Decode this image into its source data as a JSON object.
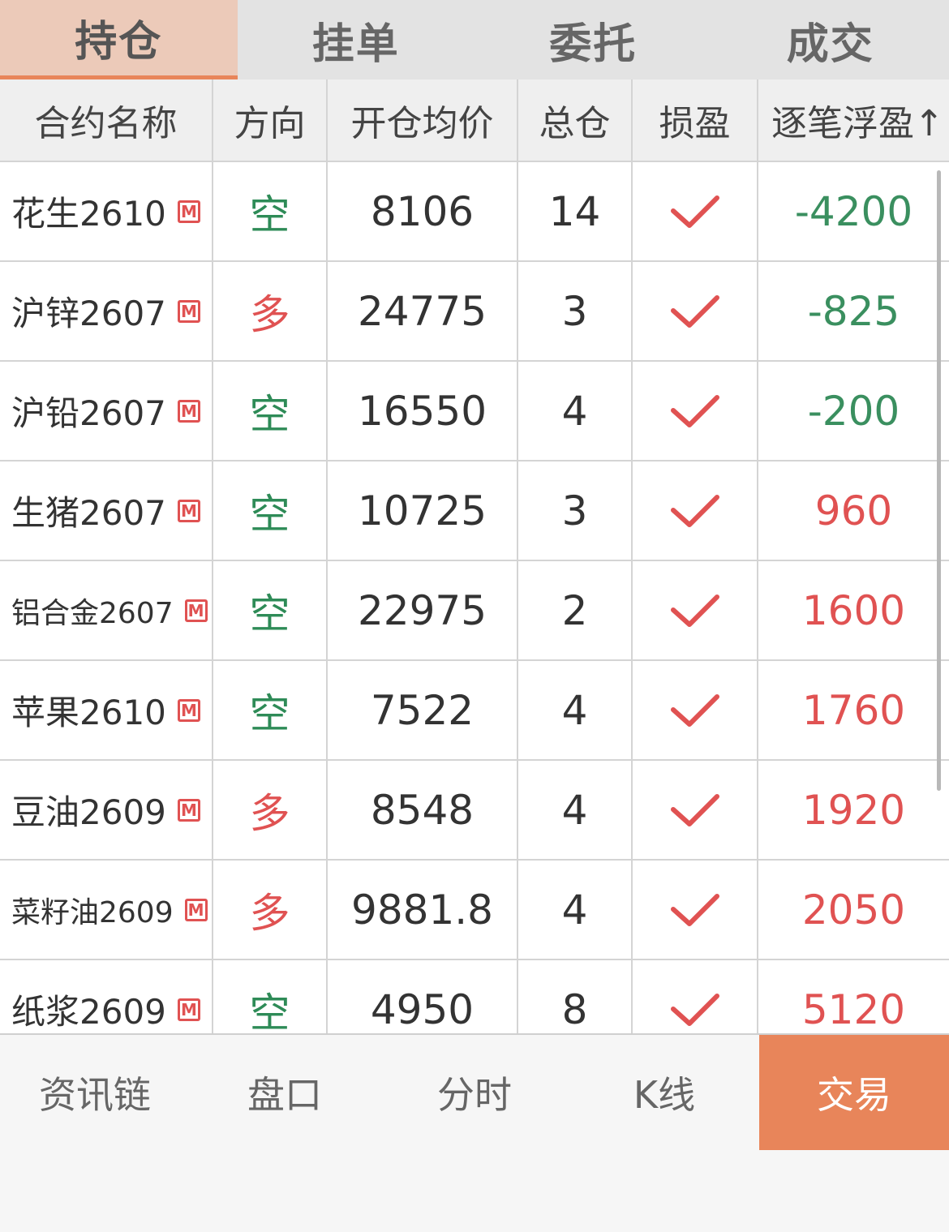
{
  "tabs": [
    {
      "label": "持仓",
      "active": true
    },
    {
      "label": "挂单",
      "active": false
    },
    {
      "label": "委托",
      "active": false
    },
    {
      "label": "成交",
      "active": false
    }
  ],
  "table": {
    "columns": [
      "合约名称",
      "方向",
      "开仓均价",
      "总仓",
      "损盈",
      "逐笔浮盈↑"
    ],
    "rows": [
      {
        "name": "花生2610",
        "badge": "M",
        "direction": "空",
        "avg_price": "8106",
        "total": "14",
        "pl": "-4200"
      },
      {
        "name": "沪锌2607",
        "badge": "M",
        "direction": "多",
        "avg_price": "24775",
        "total": "3",
        "pl": "-825"
      },
      {
        "name": "沪铅2607",
        "badge": "M",
        "direction": "空",
        "avg_price": "16550",
        "total": "4",
        "pl": "-200"
      },
      {
        "name": "生猪2607",
        "badge": "M",
        "direction": "空",
        "avg_price": "10725",
        "total": "3",
        "pl": "960"
      },
      {
        "name": "铝合金2607",
        "badge": "M",
        "direction": "空",
        "avg_price": "22975",
        "total": "2",
        "pl": "1600"
      },
      {
        "name": "苹果2610",
        "badge": "M",
        "direction": "空",
        "avg_price": "7522",
        "total": "4",
        "pl": "1760"
      },
      {
        "name": "豆油2609",
        "badge": "M",
        "direction": "多",
        "avg_price": "8548",
        "total": "4",
        "pl": "1920"
      },
      {
        "name": "菜籽油2609",
        "badge": "M",
        "direction": "多",
        "avg_price": "9881.8",
        "total": "4",
        "pl": "2050"
      },
      {
        "name": "纸浆2609",
        "badge": "M",
        "direction": "空",
        "avg_price": "4950",
        "total": "8",
        "pl": "5120"
      }
    ]
  },
  "bottom_nav": [
    {
      "label": "资讯链",
      "active": false
    },
    {
      "label": "盘口",
      "active": false
    },
    {
      "label": "分时",
      "active": false
    },
    {
      "label": "K线",
      "active": false
    },
    {
      "label": "交易",
      "active": true
    }
  ],
  "colors": {
    "accent": "#e8855a",
    "short": "#2e8b57",
    "long": "#e05252",
    "loss": "#3a8f5f",
    "profit": "#e05252"
  },
  "icons": {
    "stop_loss_set": "check-icon",
    "market_badge": "m-badge-icon"
  }
}
